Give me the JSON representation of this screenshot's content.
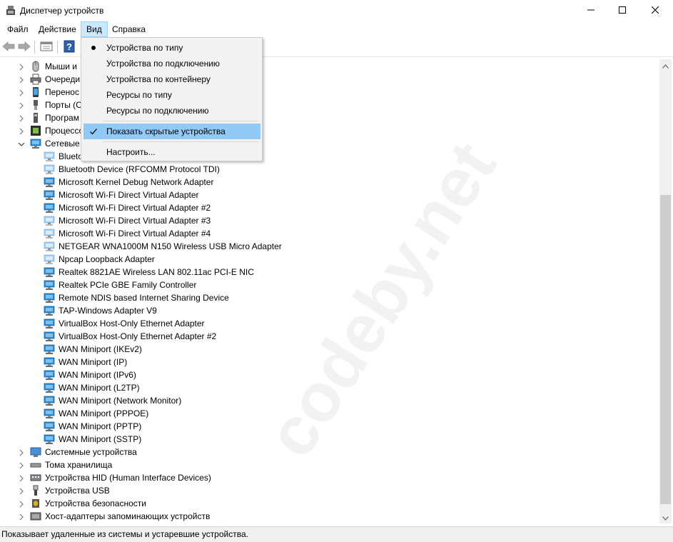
{
  "window": {
    "title": "Диспетчер устройств",
    "icon": "device-manager-icon",
    "controls": [
      "minimize-icon",
      "maximize-icon",
      "close-icon"
    ]
  },
  "menubar": {
    "items": [
      "Файл",
      "Действие",
      "Вид",
      "Справка"
    ],
    "active_index": 2
  },
  "toolbar": {
    "buttons": [
      "back-arrow-icon",
      "forward-arrow-icon",
      "properties-icon",
      "help-icon"
    ]
  },
  "tree": {
    "items": [
      {
        "label": "Мыши и",
        "indent": 0,
        "expander": "collapsed",
        "icon": "mouse-icon"
      },
      {
        "label": "Очереди",
        "indent": 0,
        "expander": "collapsed",
        "icon": "printer-icon"
      },
      {
        "label": "Перенос",
        "indent": 0,
        "expander": "collapsed",
        "icon": "portable-device-icon"
      },
      {
        "label": "Порты (С",
        "indent": 0,
        "expander": "collapsed",
        "icon": "port-icon"
      },
      {
        "label": "Програм",
        "indent": 0,
        "expander": "collapsed",
        "icon": "software-device-icon"
      },
      {
        "label": "Процессо",
        "indent": 0,
        "expander": "collapsed",
        "icon": "processor-icon"
      },
      {
        "label": "Сетевые",
        "indent": 0,
        "expander": "expanded",
        "icon": "network-adapter-icon"
      },
      {
        "label": "Blueto",
        "indent": 1,
        "icon": "network-adapter-icon",
        "hidden_device": true
      },
      {
        "label": "Bluetooth Device (RFCOMM Protocol TDI)",
        "indent": 1,
        "icon": "network-adapter-icon",
        "hidden_device": true
      },
      {
        "label": "Microsoft Kernel Debug Network Adapter",
        "indent": 1,
        "icon": "network-adapter-icon"
      },
      {
        "label": "Microsoft Wi-Fi Direct Virtual Adapter",
        "indent": 1,
        "icon": "network-adapter-icon"
      },
      {
        "label": "Microsoft Wi-Fi Direct Virtual Adapter #2",
        "indent": 1,
        "icon": "network-adapter-icon"
      },
      {
        "label": "Microsoft Wi-Fi Direct Virtual Adapter #3",
        "indent": 1,
        "icon": "network-adapter-icon",
        "hidden_device": true
      },
      {
        "label": "Microsoft Wi-Fi Direct Virtual Adapter #4",
        "indent": 1,
        "icon": "network-adapter-icon",
        "hidden_device": true
      },
      {
        "label": "NETGEAR WNA1000M N150 Wireless USB Micro Adapter",
        "indent": 1,
        "icon": "network-adapter-icon",
        "hidden_device": true
      },
      {
        "label": "Npcap Loopback Adapter",
        "indent": 1,
        "icon": "network-adapter-icon",
        "hidden_device": true
      },
      {
        "label": "Realtek 8821AE Wireless LAN 802.11ac PCI-E NIC",
        "indent": 1,
        "icon": "network-adapter-icon"
      },
      {
        "label": "Realtek PCIe GBE Family Controller",
        "indent": 1,
        "icon": "network-adapter-icon"
      },
      {
        "label": "Remote NDIS based Internet Sharing Device",
        "indent": 1,
        "icon": "network-adapter-icon"
      },
      {
        "label": "TAP-Windows Adapter V9",
        "indent": 1,
        "icon": "network-adapter-icon"
      },
      {
        "label": "VirtualBox Host-Only Ethernet Adapter",
        "indent": 1,
        "icon": "network-adapter-icon"
      },
      {
        "label": "VirtualBox Host-Only Ethernet Adapter #2",
        "indent": 1,
        "icon": "network-adapter-icon"
      },
      {
        "label": "WAN Miniport (IKEv2)",
        "indent": 1,
        "icon": "network-adapter-icon"
      },
      {
        "label": "WAN Miniport (IP)",
        "indent": 1,
        "icon": "network-adapter-icon"
      },
      {
        "label": "WAN Miniport (IPv6)",
        "indent": 1,
        "icon": "network-adapter-icon"
      },
      {
        "label": "WAN Miniport (L2TP)",
        "indent": 1,
        "icon": "network-adapter-icon"
      },
      {
        "label": "WAN Miniport (Network Monitor)",
        "indent": 1,
        "icon": "network-adapter-icon"
      },
      {
        "label": "WAN Miniport (PPPOE)",
        "indent": 1,
        "icon": "network-adapter-icon"
      },
      {
        "label": "WAN Miniport (PPTP)",
        "indent": 1,
        "icon": "network-adapter-icon"
      },
      {
        "label": "WAN Miniport (SSTP)",
        "indent": 1,
        "icon": "network-adapter-icon"
      },
      {
        "label": "Системные устройства",
        "indent": 0,
        "expander": "collapsed",
        "icon": "system-device-icon"
      },
      {
        "label": "Тома хранилища",
        "indent": 0,
        "expander": "collapsed",
        "icon": "storage-volume-icon"
      },
      {
        "label": "Устройства HID (Human Interface Devices)",
        "indent": 0,
        "expander": "collapsed",
        "icon": "hid-device-icon"
      },
      {
        "label": "Устройства USB",
        "indent": 0,
        "expander": "collapsed",
        "icon": "usb-icon"
      },
      {
        "label": "Устройства безопасности",
        "indent": 0,
        "expander": "collapsed",
        "icon": "security-device-icon"
      },
      {
        "label": "Хост-адаптеры запоминающих устройств",
        "indent": 0,
        "expander": "collapsed",
        "icon": "storage-controller-icon"
      }
    ]
  },
  "view_menu": {
    "items": [
      {
        "label": "Устройства по типу",
        "mark": "radio"
      },
      {
        "label": "Устройства по подключению",
        "mark": ""
      },
      {
        "label": "Устройства по контейнеру",
        "mark": ""
      },
      {
        "label": "Ресурсы по типу",
        "mark": ""
      },
      {
        "label": "Ресурсы по подключению",
        "mark": ""
      },
      {
        "label": "Показать скрытые устройства",
        "mark": "check",
        "highlighted": true
      },
      {
        "label": "Настроить...",
        "mark": ""
      }
    ]
  },
  "statusbar": {
    "text": "Показывает удаленные из системы и устаревшие устройства."
  },
  "watermark": {
    "text": "codeby.net"
  },
  "colors": {
    "menu_active_bg": "#cce8ff",
    "menu_highlight_bg": "#91c9f7",
    "adapter_icon": "#2f8fd6",
    "hidden_adapter_icon": "#9fcbef"
  }
}
